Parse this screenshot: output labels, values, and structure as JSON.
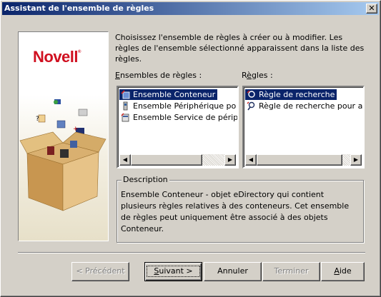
{
  "window": {
    "title": "Assistant de l'ensemble de règles",
    "close_label": "✕"
  },
  "brand": {
    "logo_text": "Novell",
    "logo_mark": "®",
    "logo_color": "#d01020"
  },
  "intro_text": "Choisissez l'ensemble de règles à créer ou à modifier. Les règles de l'ensemble sélectionné apparaissent dans la liste des règles.",
  "rulesets": {
    "label_underlined": "E",
    "label_rest": "nsembles de règles :",
    "items": [
      {
        "label": "Ensemble Conteneur",
        "icon": "container-ruleset-icon",
        "selected": true
      },
      {
        "label": "Ensemble Périphérique po",
        "icon": "device-ruleset-icon",
        "selected": false
      },
      {
        "label": "Ensemble Service de périp",
        "icon": "service-ruleset-icon",
        "selected": false
      }
    ]
  },
  "rules": {
    "label_pre": "R",
    "label_underlined": "è",
    "label_rest": "gles :",
    "items": [
      {
        "label": "Règle de recherche",
        "icon": "search-rule-icon",
        "selected": true
      },
      {
        "label": "Règle de recherche pour a",
        "icon": "search-rule-icon",
        "selected": false
      }
    ]
  },
  "description": {
    "legend": "Description",
    "text": "Ensemble Conteneur - objet eDirectory qui contient plusieurs règles relatives à des conteneurs. Cet ensemble de règles peut uniquement être associé à des objets Conteneur."
  },
  "buttons": {
    "previous": {
      "label": "< Précédent",
      "enabled": false
    },
    "next": {
      "label_underlined": "S",
      "label_rest": "uivant >",
      "enabled": true
    },
    "cancel": {
      "label": "Annuler",
      "enabled": true
    },
    "finish": {
      "label": "Terminer",
      "enabled": false
    },
    "help": {
      "label_underlined": "A",
      "label_rest": "ide",
      "enabled": true
    }
  },
  "colors": {
    "selection": "#0a246a",
    "title_gradient_start": "#0a246a",
    "title_gradient_end": "#a6caf0",
    "face": "#d4d0c8"
  }
}
